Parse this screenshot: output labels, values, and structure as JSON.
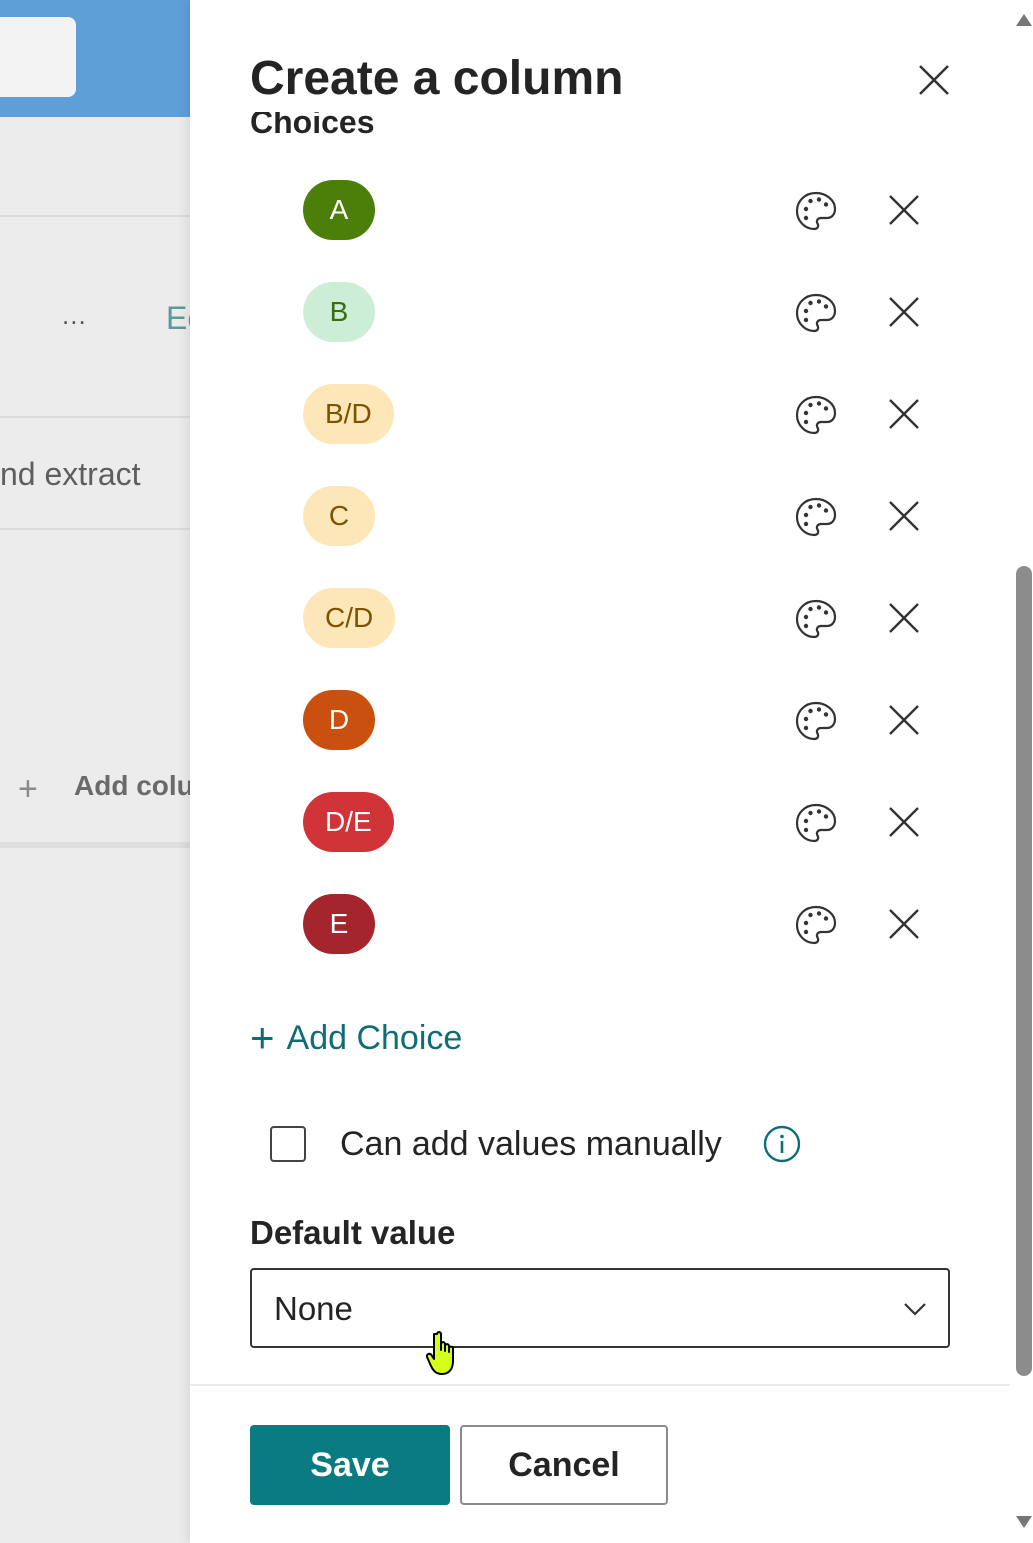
{
  "background_page": {
    "more_label": "...",
    "edit_fragment": "Ec",
    "extract_fragment": "nd extract",
    "add_column_plus": "+",
    "add_column_fragment": "Add colu"
  },
  "panel": {
    "title": "Create a column",
    "section_label": "Choices",
    "choices": [
      {
        "label": "A",
        "bg": "#4b7f0a",
        "fg": "#ffffff"
      },
      {
        "label": "B",
        "bg": "#cdeed6",
        "fg": "#3b6d11"
      },
      {
        "label": "B/D",
        "bg": "#fde7b8",
        "fg": "#7a5500"
      },
      {
        "label": "C",
        "bg": "#fde7b8",
        "fg": "#7a5500"
      },
      {
        "label": "C/D",
        "bg": "#fde7b8",
        "fg": "#7a5500"
      },
      {
        "label": "D",
        "bg": "#ca5010",
        "fg": "#ffffff"
      },
      {
        "label": "D/E",
        "bg": "#d13438",
        "fg": "#ffffff"
      },
      {
        "label": "E",
        "bg": "#a4262c",
        "fg": "#ffffff"
      }
    ],
    "add_choice": {
      "plus": "+",
      "label": "Add Choice"
    },
    "manual_values": {
      "label": "Can add values manually",
      "checked": false
    },
    "default_value": {
      "label": "Default value",
      "selected": "None"
    },
    "buttons": {
      "save": "Save",
      "cancel": "Cancel"
    }
  },
  "colors": {
    "accent": "#0a7b80",
    "link": "#0f6e75"
  }
}
